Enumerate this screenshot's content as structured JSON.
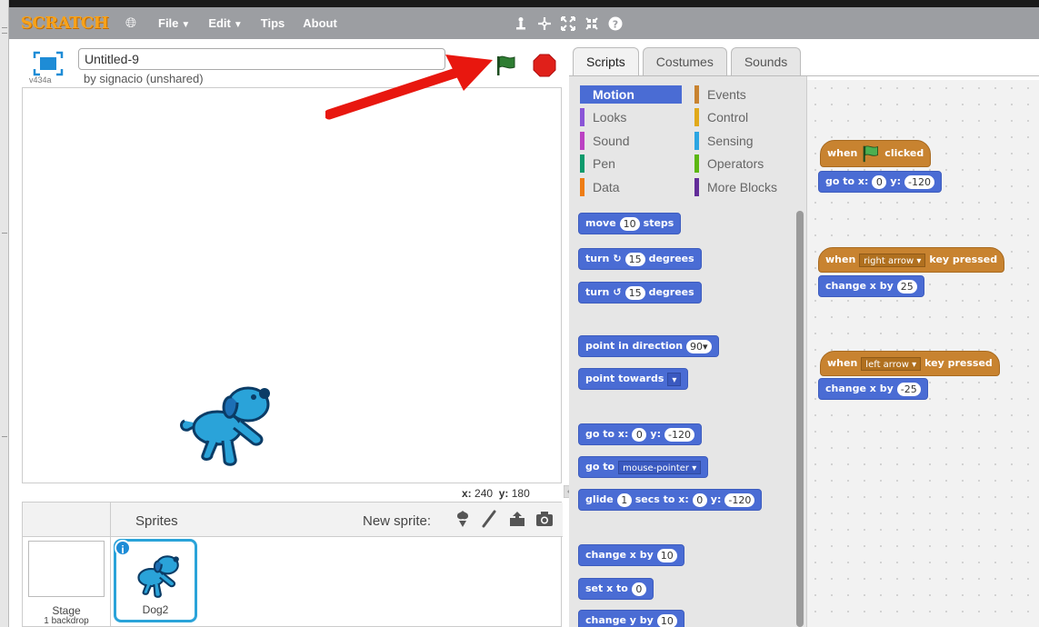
{
  "menubar": {
    "logo": "SCRATCH",
    "items": [
      {
        "label": "File",
        "caret": "▼"
      },
      {
        "label": "Edit",
        "caret": "▼"
      },
      {
        "label": "Tips",
        "caret": ""
      },
      {
        "label": "About",
        "caret": ""
      }
    ],
    "tools": [
      "duplicate-icon",
      "cut-icon",
      "grow-icon",
      "shrink-icon",
      "help-icon"
    ]
  },
  "stage_header": {
    "title": "Untitled-9",
    "byline": "by signacio (unshared)",
    "version": "v434a"
  },
  "stage": {
    "coords_x_label": "x:",
    "coords_x": "240",
    "coords_y_label": "y:",
    "coords_y": "180"
  },
  "sprites": {
    "label": "Sprites",
    "new_sprite_label": "New sprite:",
    "stage_name": "Stage",
    "stage_sub": "1 backdrop",
    "items": [
      {
        "name": "Dog2",
        "info": "i"
      }
    ]
  },
  "tabs": [
    "Scripts",
    "Costumes",
    "Sounds"
  ],
  "categories": [
    {
      "label": "Motion",
      "color": "#4a6cd4"
    },
    {
      "label": "Looks",
      "color": "#8a55d7"
    },
    {
      "label": "Sound",
      "color": "#bb42c3"
    },
    {
      "label": "Pen",
      "color": "#0e9a6c"
    },
    {
      "label": "Data",
      "color": "#ee7d16"
    },
    {
      "label": "Events",
      "color": "#c88330"
    },
    {
      "label": "Control",
      "color": "#e1a91a"
    },
    {
      "label": "Sensing",
      "color": "#2ca5e2"
    },
    {
      "label": "Operators",
      "color": "#5cb712"
    },
    {
      "label": "More Blocks",
      "color": "#632d99"
    }
  ],
  "palette_blocks": {
    "move": {
      "a": "move",
      "n": "10",
      "b": "steps"
    },
    "turn_cw": {
      "a": "turn",
      "icon": "↻",
      "n": "15",
      "b": "degrees"
    },
    "turn_ccw": {
      "a": "turn",
      "icon": "↺",
      "n": "15",
      "b": "degrees"
    },
    "point_dir": {
      "a": "point in direction",
      "n": "90▾"
    },
    "point_towards": {
      "a": "point towards",
      "d": "▾"
    },
    "goto_xy": {
      "a": "go to x:",
      "x": "0",
      "ylab": "y:",
      "y": "-120"
    },
    "goto": {
      "a": "go to",
      "d": "mouse-pointer ▾"
    },
    "glide": {
      "a": "glide",
      "n": "1",
      "b": "secs to x:",
      "x": "0",
      "ylab": "y:",
      "y": "-120"
    },
    "change_x": {
      "a": "change x by",
      "n": "10"
    },
    "set_x": {
      "a": "set x to",
      "n": "0"
    },
    "change_y": {
      "a": "change y by",
      "n": "10"
    }
  },
  "scripts": {
    "s1_hat": {
      "a": "when",
      "b": "clicked"
    },
    "s1_goto": {
      "a": "go to x:",
      "x": "0",
      "ylab": "y:",
      "y": "-120"
    },
    "s2_hat": {
      "a": "when",
      "d": "right arrow ▾",
      "b": "key pressed"
    },
    "s2_change": {
      "a": "change x by",
      "n": "25"
    },
    "s3_hat": {
      "a": "when",
      "d": "left arrow ▾",
      "b": "key pressed"
    },
    "s3_change": {
      "a": "change x by",
      "n": "-25"
    }
  },
  "colors": {
    "menubar": "#9c9ea2",
    "motion": "#4a6cd4",
    "events": "#c88330",
    "flag": "#2e7d32",
    "stop": "#e0201a",
    "arrow": "#e8170f",
    "sprite_select": "#2aa3d9"
  }
}
